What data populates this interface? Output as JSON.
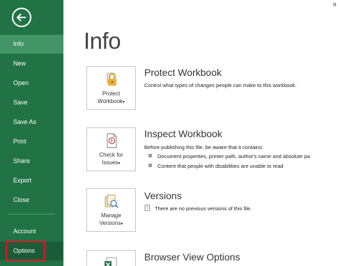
{
  "sidebar": {
    "back_label": "",
    "items": [
      {
        "label": "Info"
      },
      {
        "label": "New"
      },
      {
        "label": "Open"
      },
      {
        "label": "Save"
      },
      {
        "label": "Save As"
      },
      {
        "label": "Print"
      },
      {
        "label": "Share"
      },
      {
        "label": "Export"
      },
      {
        "label": "Close"
      },
      {
        "label": "Account"
      },
      {
        "label": "Options"
      }
    ],
    "colors": {
      "background": "#217346",
      "active": "#439467",
      "highlight": "#e81123"
    }
  },
  "corner_text": "B",
  "page_title": "Info",
  "sections": {
    "protect": {
      "button_line1": "Protect",
      "button_line2": "Workbook",
      "title": "Protect Workbook",
      "description": "Control what types of changes people can make to this workbook."
    },
    "inspect": {
      "button_line1": "Check for",
      "button_line2": "Issues",
      "title": "Inspect Workbook",
      "description": "Before publishing this file, be aware that it contains:",
      "bullets": [
        "Document properties, printer path, author's name and absolute pa",
        "Content that people with disabilities are unable to read"
      ]
    },
    "versions": {
      "button_line1": "Manage",
      "button_line2": "Versions",
      "title": "Versions",
      "description": "There are no previous versions of this file."
    },
    "browser": {
      "title": "Browser View Options"
    }
  },
  "caret_glyph": "▾"
}
